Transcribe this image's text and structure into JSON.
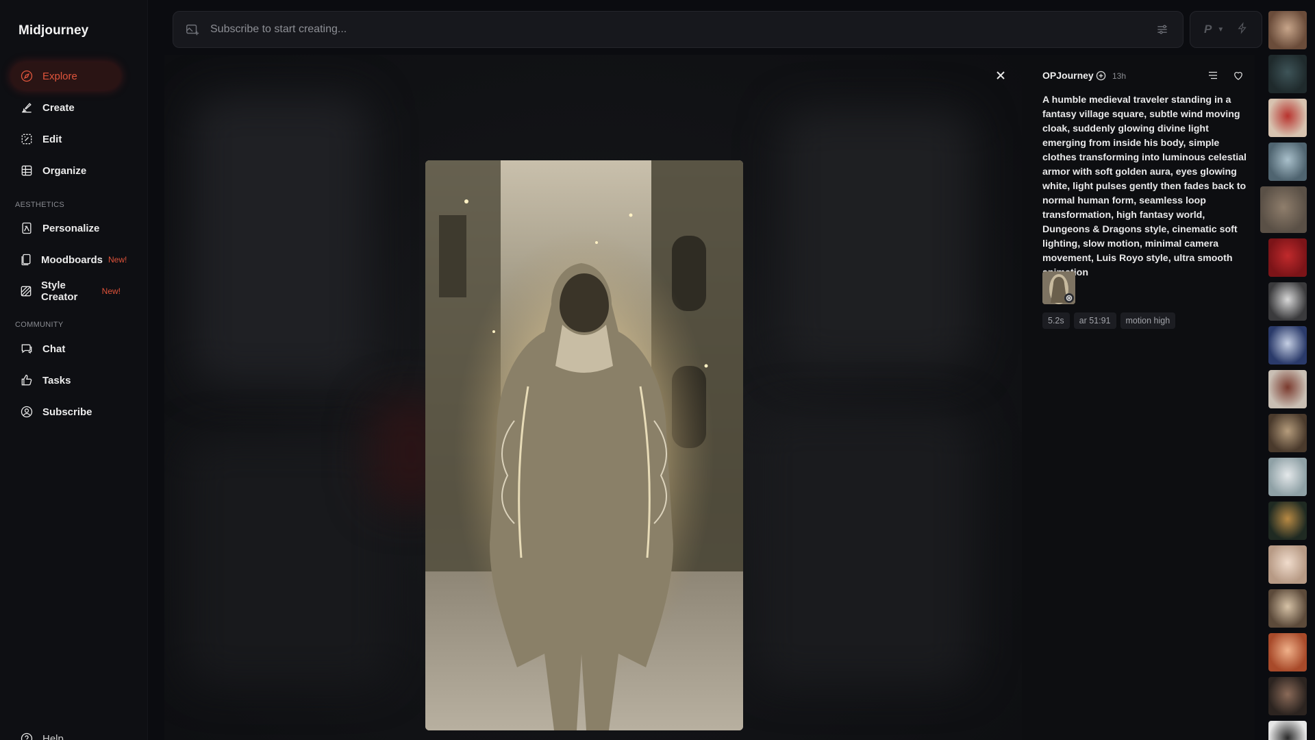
{
  "app": {
    "name": "Midjourney"
  },
  "sidebar": {
    "items": [
      {
        "label": "Explore",
        "icon": "compass-icon",
        "active": true
      },
      {
        "label": "Create",
        "icon": "brush-icon"
      },
      {
        "label": "Edit",
        "icon": "edit-icon"
      },
      {
        "label": "Organize",
        "icon": "grid-icon"
      }
    ],
    "aesthetics_label": "AESTHETICS",
    "aesthetics_items": [
      {
        "label": "Personalize",
        "icon": "personalize-icon"
      },
      {
        "label": "Moodboards",
        "icon": "moodboard-icon",
        "badge": "New!"
      },
      {
        "label": "Style Creator",
        "icon": "style-creator-icon",
        "badge": "New!"
      }
    ],
    "community_label": "COMMUNITY",
    "community_items": [
      {
        "label": "Chat",
        "icon": "chat-icon"
      },
      {
        "label": "Tasks",
        "icon": "thumbs-up-icon"
      },
      {
        "label": "Subscribe",
        "icon": "user-circle-icon"
      }
    ],
    "help_label": "Help"
  },
  "search": {
    "placeholder": "Subscribe to start creating..."
  },
  "toolbar": {
    "p_label": "P"
  },
  "detail": {
    "author": "OPJourney",
    "time": "13h",
    "prompt": "A humble medieval traveler standing in a fantasy village square, subtle wind moving cloak, suddenly glowing divine light emerging from inside his body, simple clothes transforming into luminous celestial armor with soft golden aura, eyes glowing white, light pulses gently then fades back to normal human form, seamless loop transformation, high fantasy world, Dungeons & Dragons style, cinematic soft lighting, slow motion, minimal camera movement, Luis Royo style, ultra smooth animation",
    "chips": [
      "5.2s",
      "ar 51:91",
      "motion high"
    ]
  },
  "colors": {
    "accent": "#e0553c",
    "background": "#0b0c10"
  },
  "thumbnails": [
    {
      "bg": "#6a4c3a",
      "fg": "#c7a58a"
    },
    {
      "bg": "#1f2a2c",
      "fg": "#3e5458"
    },
    {
      "bg": "#d7c3b0",
      "fg": "#b8332e"
    },
    {
      "bg": "#4f6470",
      "fg": "#a9c0cb"
    },
    {
      "bg": "#5a5046",
      "fg": "#8f7e6c"
    },
    {
      "bg": "#7c1418",
      "fg": "#c02a2c"
    },
    {
      "bg": "#3a3a3c",
      "fg": "#d8d8d8"
    },
    {
      "bg": "#2a3a6a",
      "fg": "#c5cfe4"
    },
    {
      "bg": "#c9bfb4",
      "fg": "#7a3a2e"
    },
    {
      "bg": "#4a3a2c",
      "fg": "#b59c7c"
    },
    {
      "bg": "#8fa1a6",
      "fg": "#e4e8ea"
    },
    {
      "bg": "#1f2a22",
      "fg": "#b88a44"
    },
    {
      "bg": "#b79a85",
      "fg": "#f0dccc"
    },
    {
      "bg": "#5c4a3a",
      "fg": "#d6c2a6"
    },
    {
      "bg": "#a84a2a",
      "fg": "#f0b18a"
    },
    {
      "bg": "#2c2420",
      "fg": "#8a6a58"
    },
    {
      "bg": "#e6e6e6",
      "fg": "#2a2a2a"
    }
  ]
}
